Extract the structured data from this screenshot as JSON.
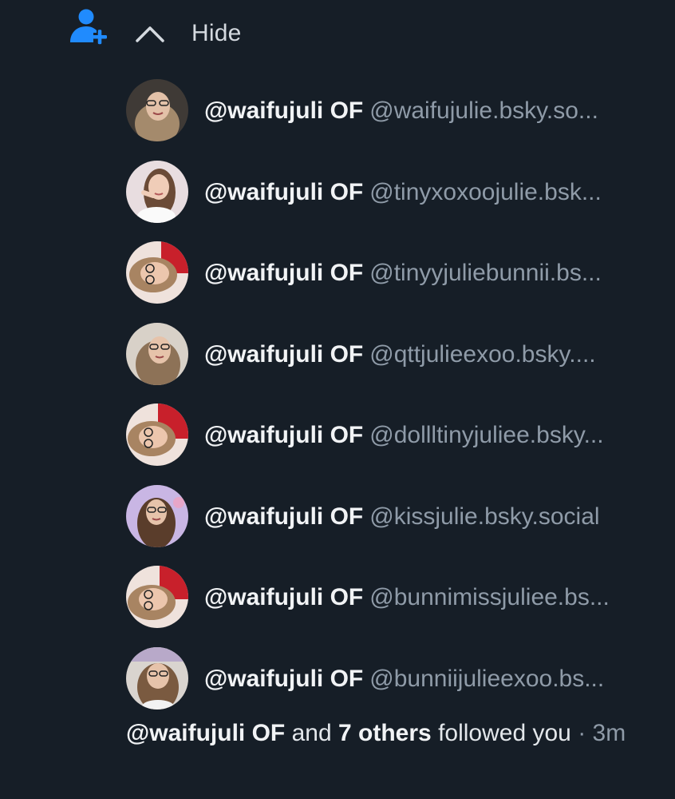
{
  "colors": {
    "background": "#161e27",
    "accent": "#208bfe",
    "text_primary": "#f1f3f5",
    "text_secondary": "#8f9ba8"
  },
  "header": {
    "icon": "person-plus-icon",
    "toggle_icon": "chevron-up-icon",
    "toggle_label": "Hide"
  },
  "followers": [
    {
      "name": "@waifujuli OF",
      "handle": "@waifujulie.bsky.so..."
    },
    {
      "name": "@waifujuli OF",
      "handle": "@tinyxoxoojulie.bsk..."
    },
    {
      "name": "@waifujuli OF",
      "handle": "@tinyyjuliebunnii.bs..."
    },
    {
      "name": "@waifujuli OF",
      "handle": "@qttjulieexoo.bsky...."
    },
    {
      "name": "@waifujuli OF",
      "handle": "@dollltinyjuliee.bsky..."
    },
    {
      "name": "@waifujuli OF",
      "handle": "@kissjulie.bsky.social"
    },
    {
      "name": "@waifujuli OF",
      "handle": "@bunnimissjuliee.bs..."
    },
    {
      "name": "@waifujuli OF",
      "handle": "@bunniijulieexoo.bs..."
    }
  ],
  "summary": {
    "actor": "@waifujuli OF",
    "and": "and",
    "others": "7 others",
    "action": "followed you",
    "separator": "·",
    "time": "3m"
  }
}
